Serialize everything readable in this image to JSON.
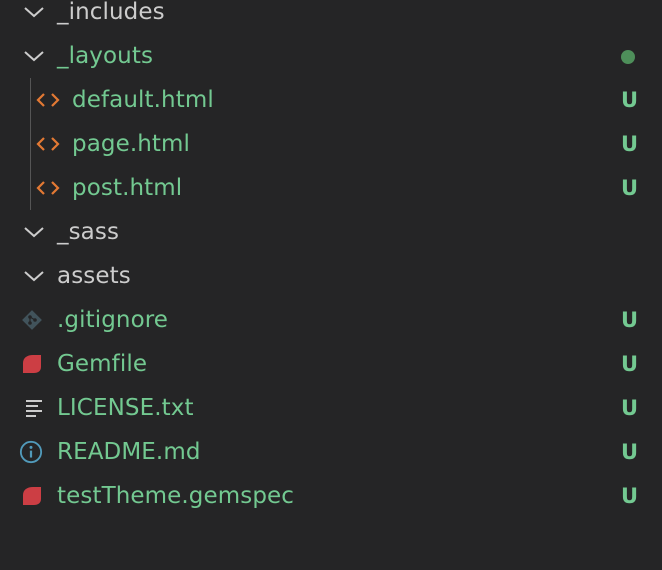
{
  "colors": {
    "background": "#252526",
    "folder_text": "#cccccc",
    "untracked_text": "#73c991",
    "status_untracked": "#73c991",
    "dot_modified": "#4e8f5a",
    "html_icon": "#e37933",
    "ruby_icon": "#cc3e44",
    "git_icon": "#41535b",
    "info_icon": "#519aba",
    "text_icon": "#cccccc",
    "chevron": "#cccccc"
  },
  "explorer": {
    "items": [
      {
        "label": "_includes",
        "type": "folder",
        "status": ""
      },
      {
        "label": "_layouts",
        "type": "folder",
        "status": "dot"
      },
      {
        "label": "default.html",
        "type": "html",
        "status": "U"
      },
      {
        "label": "page.html",
        "type": "html",
        "status": "U"
      },
      {
        "label": "post.html",
        "type": "html",
        "status": "U"
      },
      {
        "label": "_sass",
        "type": "folder",
        "status": ""
      },
      {
        "label": "assets",
        "type": "folder",
        "status": ""
      },
      {
        "label": ".gitignore",
        "type": "git",
        "status": "U"
      },
      {
        "label": "Gemfile",
        "type": "ruby",
        "status": "U"
      },
      {
        "label": "LICENSE.txt",
        "type": "text",
        "status": "U"
      },
      {
        "label": "README.md",
        "type": "info",
        "status": "U"
      },
      {
        "label": "testTheme.gemspec",
        "type": "ruby",
        "status": "U"
      }
    ]
  }
}
